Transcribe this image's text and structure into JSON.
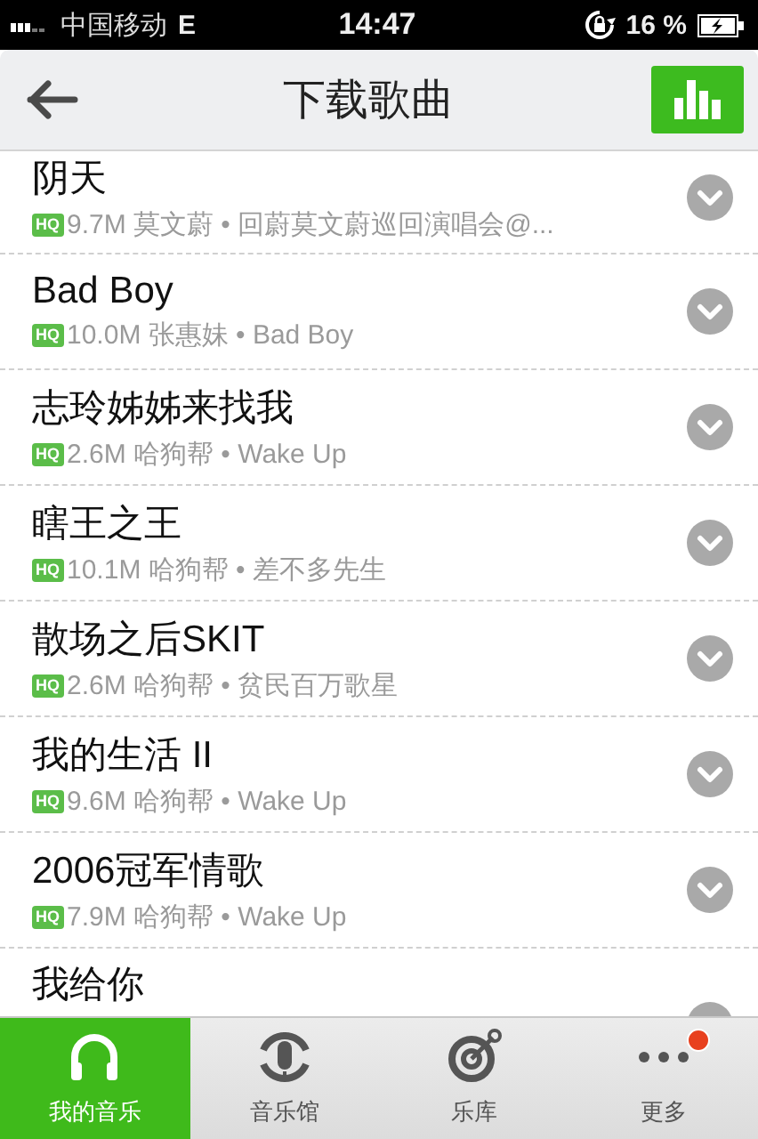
{
  "status_bar": {
    "carrier": "中国移动",
    "network": "E",
    "time": "14:47",
    "battery": "16 %"
  },
  "nav": {
    "title": "下载歌曲"
  },
  "songs": [
    {
      "title": "阴天",
      "quality": "HQ",
      "details": "9.7M 莫文蔚 • 回蔚莫文蔚巡回演唱会@..."
    },
    {
      "title": "Bad  Boy",
      "quality": "HQ",
      "details": "10.0M 张惠妹 • Bad Boy"
    },
    {
      "title": "志玲姊姊来找我",
      "quality": "HQ",
      "details": "2.6M 哈狗帮 • Wake Up"
    },
    {
      "title": "瞎王之王",
      "quality": "HQ",
      "details": "10.1M 哈狗帮 • 差不多先生"
    },
    {
      "title": "散场之后SKIT",
      "quality": "HQ",
      "details": "2.6M 哈狗帮 • 贫民百万歌星"
    },
    {
      "title": "我的生活 II",
      "quality": "HQ",
      "details": "9.6M 哈狗帮 • Wake Up"
    },
    {
      "title": "2006冠军情歌",
      "quality": "HQ",
      "details": "7.9M 哈狗帮 • Wake Up"
    },
    {
      "title": "我给你"
    }
  ],
  "tabs": [
    {
      "label": "我的音乐",
      "selected": true,
      "badge": false
    },
    {
      "label": "音乐馆",
      "selected": false,
      "badge": false
    },
    {
      "label": "乐库",
      "selected": false,
      "badge": false
    },
    {
      "label": "更多",
      "selected": false,
      "badge": true
    }
  ]
}
